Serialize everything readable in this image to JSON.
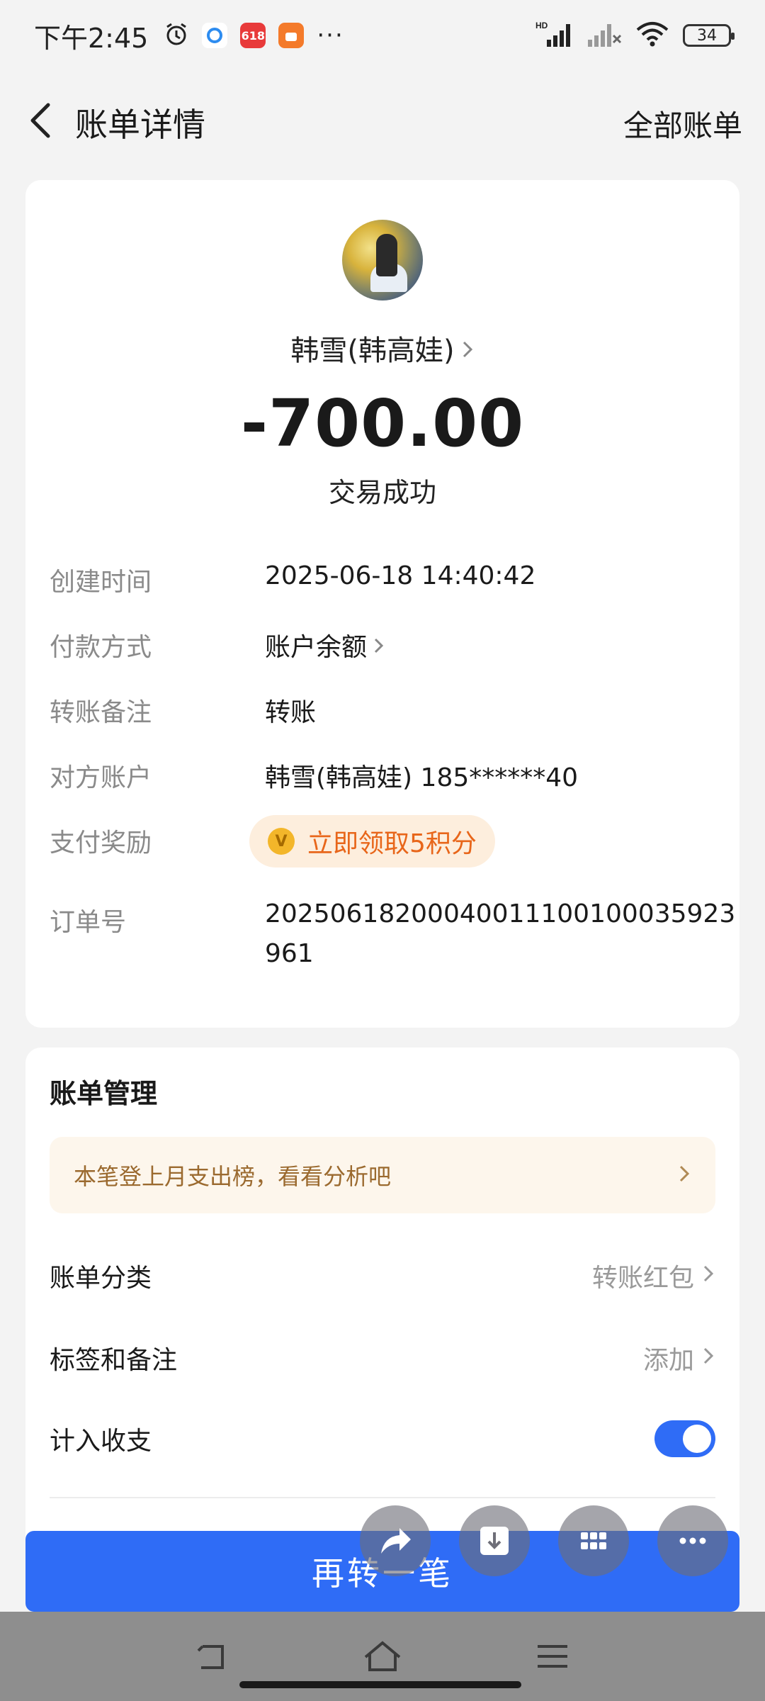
{
  "status_bar": {
    "time": "下午2:45",
    "battery": "34",
    "left_icons": [
      "alarm-icon",
      "app-icon-1",
      "app-icon-618",
      "app-icon-orange"
    ],
    "right_icons": [
      "hd-signal-icon",
      "signal-off-icon",
      "wifi-icon"
    ]
  },
  "header": {
    "title": "账单详情",
    "right_link": "全部账单"
  },
  "transaction": {
    "counterparty": "韩雪(韩高娃)",
    "amount": "-700.00",
    "status": "交易成功"
  },
  "details": [
    {
      "label": "创建时间",
      "value": "2025-06-18 14:40:42"
    },
    {
      "label": "付款方式",
      "value": "账户余额"
    },
    {
      "label": "转账备注",
      "value": "转账"
    },
    {
      "label": "对方账户",
      "value": "韩雪(韩高娃) 185******40"
    },
    {
      "label": "支付奖励",
      "value": "立即领取5积分"
    },
    {
      "label": "订单号",
      "value": "20250618200040011100100035923961"
    }
  ],
  "management": {
    "title": "账单管理",
    "banner": "本笔登上月支出榜，看看分析吧",
    "rows": [
      {
        "label": "账单分类",
        "value": "转账红包"
      },
      {
        "label": "标签和备注",
        "value": "添加"
      },
      {
        "label": "计入收支",
        "toggle": true
      }
    ]
  },
  "primary_button": "再转一笔",
  "colors": {
    "primary": "#2f6cf6",
    "reward_text": "#e8661a",
    "banner_text": "#9b6a2f"
  }
}
